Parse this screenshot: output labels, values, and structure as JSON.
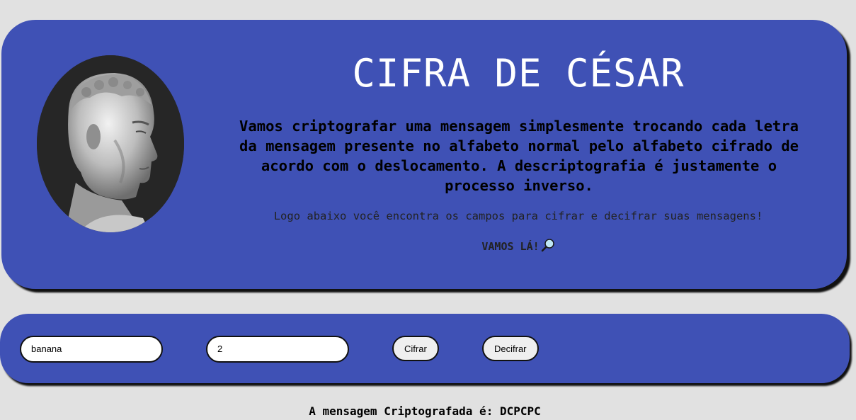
{
  "header": {
    "title": "CIFRA DE CÉSAR",
    "description": "Vamos criptografar uma mensagem simplesmente trocando cada letra da mensagem presente no alfabeto normal pelo alfabeto cifrado de acordo com o deslocamento. A descriptografia é justamente o processo inverso.",
    "hint": "Logo abaixo você encontra os campos para cifrar e decifrar suas mensagens!",
    "cta": "VAMOS LÁ!",
    "cta_icon": "magnifying-glass-icon",
    "portrait": "julius-caesar-bust"
  },
  "form": {
    "message_value": "banana",
    "shift_value": "2",
    "encrypt_label": "Cifrar",
    "decrypt_label": "Decifrar"
  },
  "result": {
    "text": "A mensagem Criptografada é: DCPCPC"
  },
  "colors": {
    "panel": "#3f51b5",
    "background": "#e1e1e1"
  }
}
